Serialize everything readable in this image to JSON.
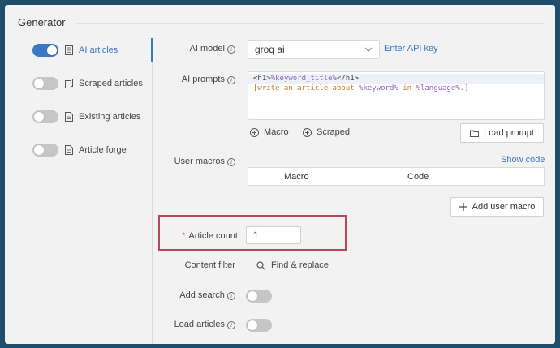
{
  "section_title": "Generator",
  "sidebar": {
    "items": [
      {
        "label": "AI articles",
        "on": true,
        "icon": "ai-article-icon"
      },
      {
        "label": "Scraped articles",
        "on": false,
        "icon": "copy-icon"
      },
      {
        "label": "Existing articles",
        "on": false,
        "icon": "document-icon"
      },
      {
        "label": "Article forge",
        "on": false,
        "icon": "document-icon"
      }
    ]
  },
  "form": {
    "ai_model": {
      "label": "AI model",
      "value": "groq ai",
      "link": "Enter API key"
    },
    "ai_prompts": {
      "label": "AI prompts",
      "lines": [
        {
          "tag_open": "<h1>",
          "var": "%keyword_title%",
          "tag_close": "</h1>"
        },
        {
          "pre": "[write an article about ",
          "var1": "%keyword%",
          "mid": " in ",
          "var2": "%language%",
          "post": ".]"
        }
      ],
      "macro_button": "Macro",
      "scraped_button": "Scraped",
      "load_prompt_button": "Load prompt"
    },
    "user_macros": {
      "label": "User macros",
      "show_code": "Show code",
      "columns": [
        "Macro",
        "Code"
      ],
      "add_button": "Add user macro"
    },
    "article_count": {
      "label": "Article count",
      "value": "1"
    },
    "content_filter": {
      "label": "Content filter",
      "button": "Find & replace"
    },
    "add_search": {
      "label": "Add search",
      "on": false
    },
    "load_articles": {
      "label": "Load articles",
      "on": false
    }
  },
  "colors": {
    "accent": "#3a78c4",
    "highlight_border": "#b5485a",
    "required": "#e05050"
  }
}
